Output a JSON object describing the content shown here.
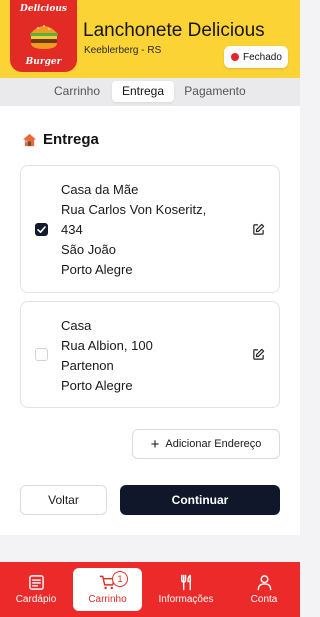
{
  "header": {
    "logo": {
      "top_text": "Delicious",
      "bottom_text": "Burger"
    },
    "store_name": "Lanchonete Delicious",
    "location": "Keeblerberg - RS",
    "status": {
      "label": "Fechado",
      "color": "#e2262c"
    }
  },
  "tabs": [
    {
      "label": "Carrinho",
      "active": false
    },
    {
      "label": "Entrega",
      "active": true
    },
    {
      "label": "Pagamento",
      "active": false
    }
  ],
  "delivery": {
    "section_icon": "house-icon",
    "title": "Entrega",
    "addresses": [
      {
        "selected": true,
        "lines": [
          "Casa da Mãe",
          "Rua Carlos Von Koseritz,",
          "434",
          "São João",
          "Porto Alegre"
        ]
      },
      {
        "selected": false,
        "lines": [
          "Casa",
          "Rua Albion, 100",
          "Partenon",
          "Porto Alegre"
        ]
      }
    ],
    "add_address_label": "Adicionar Endereço"
  },
  "actions": {
    "back_label": "Voltar",
    "continue_label": "Continuar"
  },
  "bottom_nav": [
    {
      "label": "Cardápio",
      "icon": "menu-list-icon",
      "active": false
    },
    {
      "label": "Carrinho",
      "icon": "cart-icon",
      "active": true,
      "badge": "1"
    },
    {
      "label": "Informações",
      "icon": "utensils-icon",
      "active": false
    },
    {
      "label": "Conta",
      "icon": "user-icon",
      "active": false
    }
  ],
  "colors": {
    "header": "#fcd335",
    "brand_red": "#ec2a2a",
    "primary_button": "#10172b"
  }
}
